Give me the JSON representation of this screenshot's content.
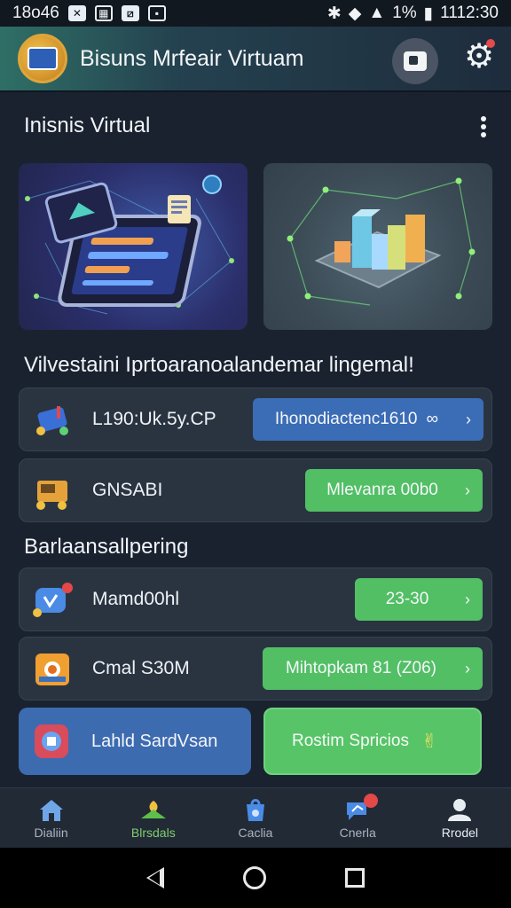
{
  "status_bar": {
    "time_left": "18o46",
    "battery": "1%",
    "time_right": "1112:30"
  },
  "app_bar": {
    "title": "Bisuns Mrfeair Virtuam"
  },
  "section1": {
    "title": "Inisnis Virtual"
  },
  "section2": {
    "title": "Vilvestaini Iprtoaranoalandemar lingemal!",
    "items": [
      {
        "label": "L190:Uk.5y.CP",
        "action": "Ihonodiactenc1610",
        "action_suffix": "∞",
        "style": "blue"
      },
      {
        "label": "GNSABI",
        "action": "Mlevanra 00b0",
        "style": "green"
      }
    ]
  },
  "section3": {
    "title": "Barlaansallpering",
    "items": [
      {
        "label": "Mamd00hl",
        "action": "23-30",
        "style": "green"
      },
      {
        "label": "Cmal S30M",
        "action": "Mihtopkam 81 (Z06)",
        "style": "green"
      }
    ]
  },
  "tiles": {
    "left_label": "Lahld SardVsan",
    "right_label": "Rostim Spricios"
  },
  "tabs": [
    {
      "label": "Dialiin"
    },
    {
      "label": "Blrsdals"
    },
    {
      "label": "Caclia"
    },
    {
      "label": "Cnerla"
    },
    {
      "label": "Rrodel"
    }
  ],
  "colors": {
    "background": "#1a2230",
    "card": "#2a3441",
    "action_blue": "#3b6cb6",
    "action_green": "#52bf65",
    "active_tab": "#7fcf6d"
  }
}
